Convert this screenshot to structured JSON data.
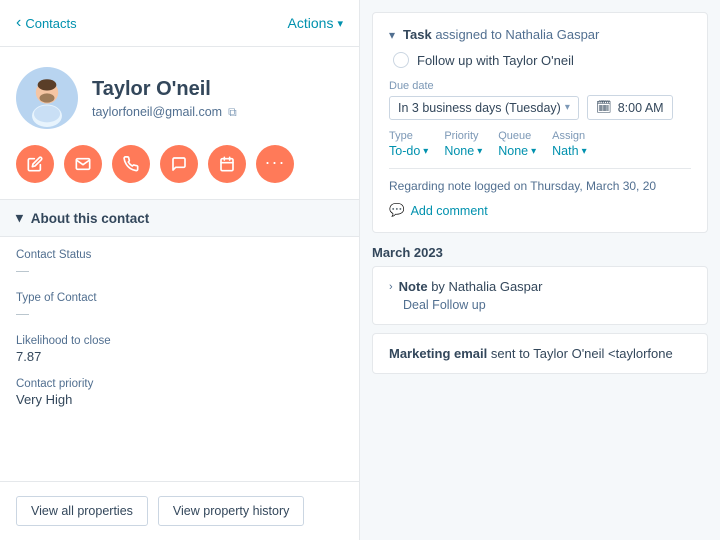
{
  "left": {
    "back_label": "Contacts",
    "actions_label": "Actions",
    "contact": {
      "name": "Taylor O'neil",
      "email": "taylorfoneil@gmail.com"
    },
    "action_buttons": [
      {
        "icon": "✏️",
        "name": "edit-icon"
      },
      {
        "icon": "✉",
        "name": "email-icon"
      },
      {
        "icon": "📞",
        "name": "phone-icon"
      },
      {
        "icon": "💬",
        "name": "chat-icon"
      },
      {
        "icon": "📅",
        "name": "calendar-icon"
      },
      {
        "icon": "•••",
        "name": "more-icon"
      }
    ],
    "section_title": "About this contact",
    "properties": [
      {
        "label": "Contact Status",
        "value": "",
        "empty": true
      },
      {
        "label": "Type of Contact",
        "value": "",
        "empty": true
      },
      {
        "label": "Likelihood to close",
        "value": "7.87"
      },
      {
        "label": "Contact priority",
        "value": "Very High"
      }
    ],
    "buttons": {
      "view_all": "View all properties",
      "view_history": "View property history"
    }
  },
  "right": {
    "task": {
      "assigned_prefix": "Task",
      "assigned_label": "assigned to Nathalia Gaspar",
      "task_text": "Follow up with Taylor O'neil",
      "due_date_label": "Due date",
      "due_date_value": "In 3 business days (Tuesday)",
      "time_icon": "🗓",
      "time_value": "8:00 AM",
      "type_label": "Type",
      "type_value": "To-do",
      "priority_label": "Priority",
      "priority_value": "None",
      "queue_label": "Queue",
      "queue_value": "None",
      "assignee_label": "Assign",
      "assignee_value": "Nath",
      "note_text": "Regarding note logged on Thursday, March 30, 20",
      "add_comment": "Add comment"
    },
    "month_divider": "March 2023",
    "note_activity": {
      "type": "Note",
      "by_label": "by Nathalia Gaspar",
      "subtitle": "Deal Follow up"
    },
    "marketing_activity": {
      "type": "Marketing email",
      "sent_label": "sent to Taylor O'neil <taylorfone"
    }
  }
}
